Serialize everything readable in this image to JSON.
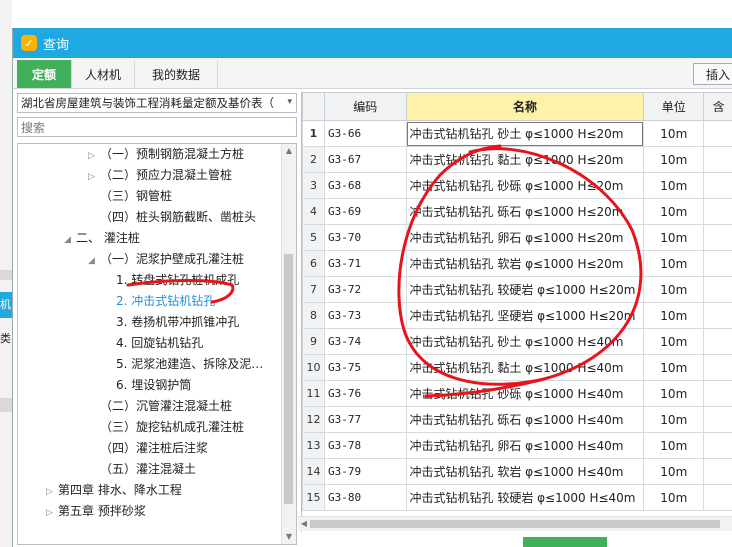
{
  "window": {
    "title": "查询",
    "logo_glyph": "✓"
  },
  "tabs": [
    {
      "label": "定额",
      "active": true
    },
    {
      "label": "人材机",
      "active": false
    },
    {
      "label": "我的数据",
      "active": false
    }
  ],
  "toolbar": {
    "insert_label": "插入"
  },
  "library": {
    "selected": "湖北省房屋建筑与装饰工程消耗量定额及基价表（",
    "arrow": "▾"
  },
  "search": {
    "placeholder": "搜索"
  },
  "tree": [
    {
      "label": "（一）预制钢筋混凝土方桩",
      "toggle": "▷"
    },
    {
      "label": "（二）预应力混凝土管桩",
      "toggle": "▷"
    },
    {
      "label": "（三）钢管桩",
      "toggle": ""
    },
    {
      "label": "（四）桩头钢筋截断、凿桩头",
      "toggle": ""
    },
    {
      "label": "二、 灌注桩",
      "toggle": "◢"
    },
    {
      "label": "（一）泥浆护壁成孔灌注桩",
      "toggle": "◢"
    },
    {
      "label": "1. 转盘式钻孔桩机成孔",
      "toggle": ""
    },
    {
      "label": "2. 冲击式钻机钻孔",
      "toggle": "",
      "selected": true
    },
    {
      "label": "3. 卷扬机带冲抓锥冲孔",
      "toggle": ""
    },
    {
      "label": "4. 回旋钻机钻孔",
      "toggle": ""
    },
    {
      "label": "5. 泥浆池建造、拆除及泥…",
      "toggle": ""
    },
    {
      "label": "6. 埋设钢护筒",
      "toggle": ""
    },
    {
      "label": "（二）沉管灌注混凝土桩",
      "toggle": ""
    },
    {
      "label": "（三）旋挖钻机成孔灌注桩",
      "toggle": ""
    },
    {
      "label": "（四）灌注桩后注浆",
      "toggle": ""
    },
    {
      "label": "（五）灌注混凝土",
      "toggle": ""
    },
    {
      "label": "第四章 排水、降水工程",
      "toggle": "▷"
    },
    {
      "label": "第五章 预拌砂浆",
      "toggle": "▷"
    }
  ],
  "grid": {
    "columns": [
      "编码",
      "名称",
      "单位",
      "含"
    ],
    "rows": [
      {
        "no": "1",
        "code": "G3-66",
        "name": "冲击式钻机钻孔 砂土 φ≤1000 H≤20m",
        "unit": "10m"
      },
      {
        "no": "2",
        "code": "G3-67",
        "name": "冲击式钻机钻孔 黏土 φ≤1000 H≤20m",
        "unit": "10m"
      },
      {
        "no": "3",
        "code": "G3-68",
        "name": "冲击式钻机钻孔 砂砾 φ≤1000 H≤20m",
        "unit": "10m"
      },
      {
        "no": "4",
        "code": "G3-69",
        "name": "冲击式钻机钻孔 砾石 φ≤1000 H≤20m",
        "unit": "10m"
      },
      {
        "no": "5",
        "code": "G3-70",
        "name": "冲击式钻机钻孔 卵石 φ≤1000 H≤20m",
        "unit": "10m"
      },
      {
        "no": "6",
        "code": "G3-71",
        "name": "冲击式钻机钻孔 软岩 φ≤1000 H≤20m",
        "unit": "10m"
      },
      {
        "no": "7",
        "code": "G3-72",
        "name": "冲击式钻机钻孔 较硬岩 φ≤1000 H≤20m",
        "unit": "10m"
      },
      {
        "no": "8",
        "code": "G3-73",
        "name": "冲击式钻机钻孔 坚硬岩 φ≤1000 H≤20m",
        "unit": "10m"
      },
      {
        "no": "9",
        "code": "G3-74",
        "name": "冲击式钻机钻孔 砂土 φ≤1000 H≤40m",
        "unit": "10m"
      },
      {
        "no": "10",
        "code": "G3-75",
        "name": "冲击式钻机钻孔 黏土 φ≤1000 H≤40m",
        "unit": "10m"
      },
      {
        "no": "11",
        "code": "G3-76",
        "name": "冲击式钻机钻孔 砂砾 φ≤1000 H≤40m",
        "unit": "10m"
      },
      {
        "no": "12",
        "code": "G3-77",
        "name": "冲击式钻机钻孔 砾石 φ≤1000 H≤40m",
        "unit": "10m"
      },
      {
        "no": "13",
        "code": "G3-78",
        "name": "冲击式钻机钻孔 卵石 φ≤1000 H≤40m",
        "unit": "10m"
      },
      {
        "no": "14",
        "code": "G3-79",
        "name": "冲击式钻机钻孔 软岩 φ≤1000 H≤40m",
        "unit": "10m"
      },
      {
        "no": "15",
        "code": "G3-80",
        "name": "冲击式钻机钻孔 较硬岩 φ≤1000 H≤40m",
        "unit": "10m"
      }
    ]
  },
  "background_app": {
    "labels": [
      "机",
      "类别"
    ]
  },
  "colors": {
    "titlebar": "#1fa9e0",
    "active_tab": "#41b05a",
    "selected_text": "#1f8fde",
    "header_highlight": "#fff2a8",
    "annotation": "#e8141b"
  }
}
